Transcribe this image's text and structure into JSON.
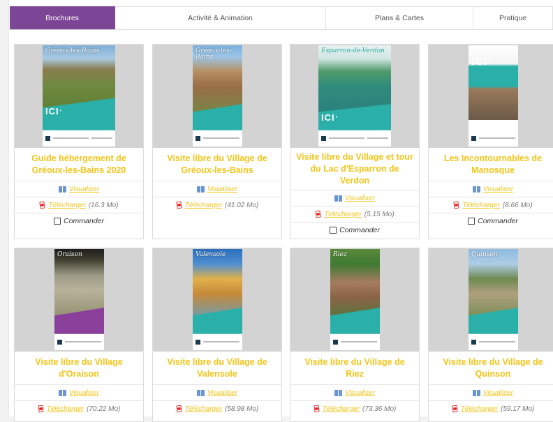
{
  "tabs": [
    {
      "label": "Brochures",
      "active": true
    },
    {
      "label": "Activité & Animation",
      "active": false
    },
    {
      "label": "Plans & Cartes",
      "active": false
    },
    {
      "label": "Pratique",
      "active": false
    }
  ],
  "colors": {
    "accent": "#7d4596",
    "title": "#f2c51a",
    "teal": "#2ab0a8"
  },
  "actions": {
    "view": "Visualiser",
    "download": "Télécharger",
    "order": "Commander"
  },
  "cards": [
    {
      "title": "Guide hébergement de Gréoux-les-Bains 2020",
      "size": "(16.3 Mo)",
      "cover_title": "Gréoux-les-Bains"
    },
    {
      "title": "Visite libre du Village de Gréoux-les-Bains",
      "size": "(41.02 Mo)",
      "cover_title": "Gréoux-les-Bains"
    },
    {
      "title": "Visite libre du Village et tour du Lac d'Esparron de Verdon",
      "size": "(5.15 Mo)",
      "cover_title": "Esparron-de-Verdon"
    },
    {
      "title": "Les Incontournables de Manosque",
      "size": "(8.66 Mo)",
      "cover_title": ""
    },
    {
      "title": "Visite libre du Village d'Oraison",
      "size": "(70.22 Mo)",
      "cover_title": "Oraison"
    },
    {
      "title": "Visite libre du Village de Valensole",
      "size": "(58.98 Mo)",
      "cover_title": "Valensole"
    },
    {
      "title": "Visite libre du Village de Riez",
      "size": "(73.36 Mo)",
      "cover_title": "Riez"
    },
    {
      "title": "Visite libre du Village de Quinson",
      "size": "(59.17 Mo)",
      "cover_title": "Quinson"
    }
  ]
}
